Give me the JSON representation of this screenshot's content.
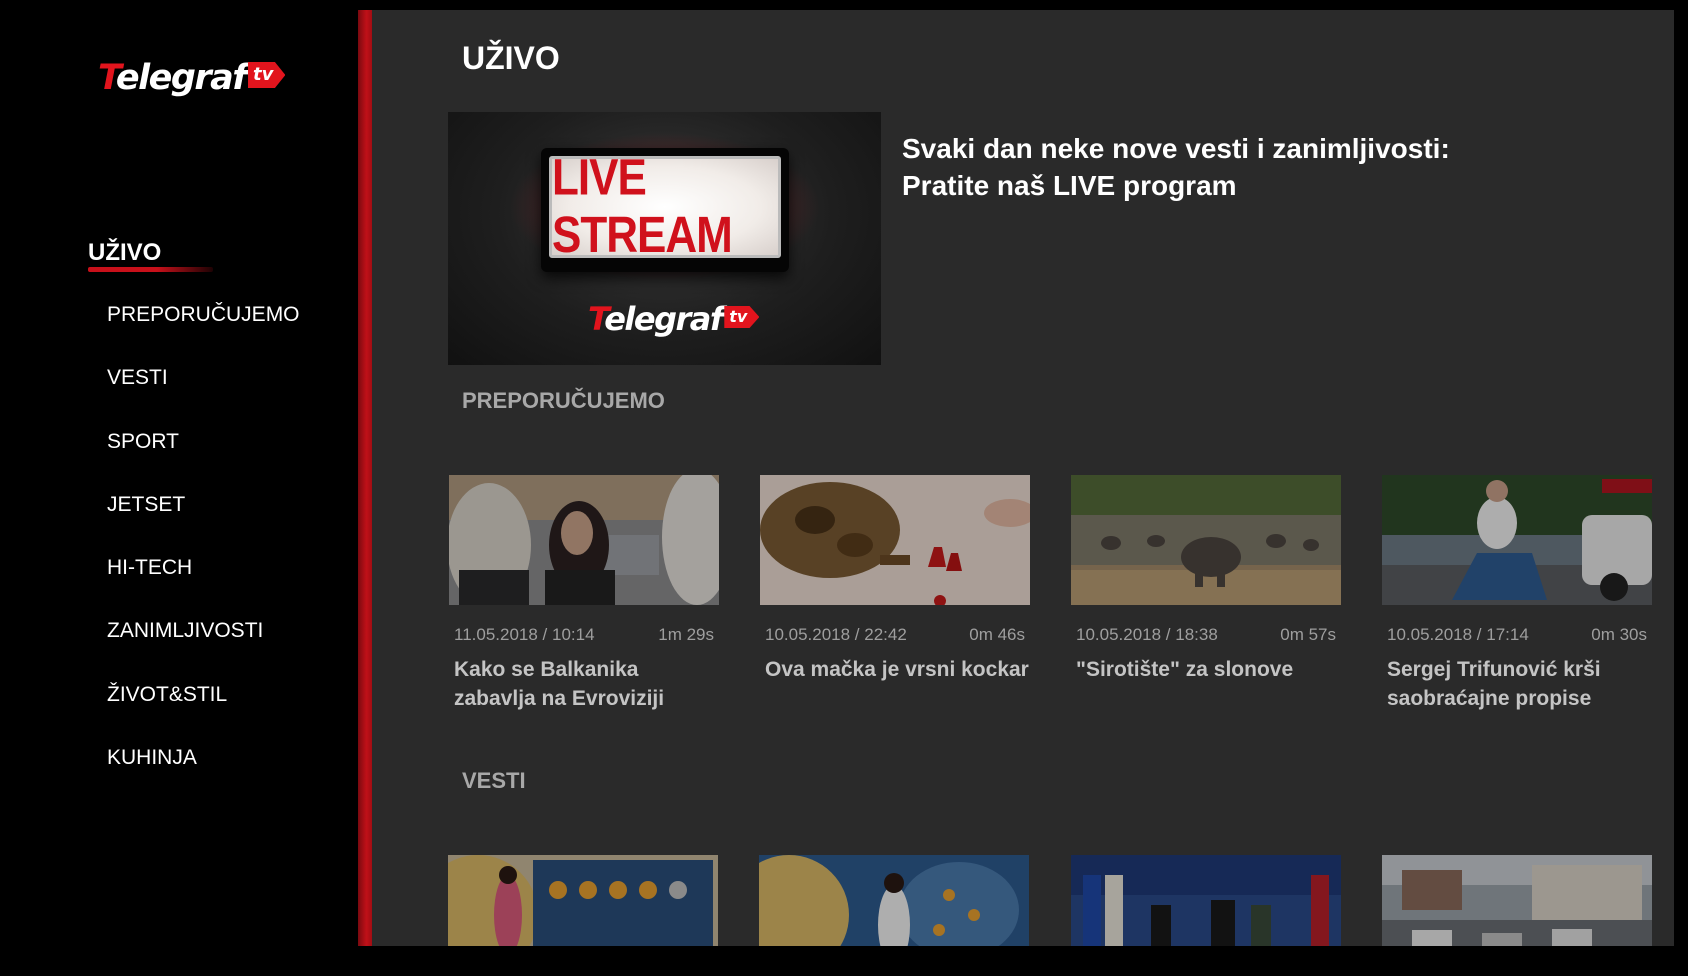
{
  "logo": {
    "first_letter": "T",
    "word_rest": "elegraf",
    "tv": "tv"
  },
  "sidebar": {
    "items": [
      {
        "label": "UŽIVO",
        "active": true
      },
      {
        "label": "PREPORUČUJEMO",
        "active": false
      },
      {
        "label": "VESTI",
        "active": false
      },
      {
        "label": "SPORT",
        "active": false
      },
      {
        "label": "JETSET",
        "active": false
      },
      {
        "label": "HI-TECH",
        "active": false
      },
      {
        "label": "ZANIMLJIVOSTI",
        "active": false
      },
      {
        "label": "ŽIVOT&STIL",
        "active": false
      },
      {
        "label": "KUHINJA",
        "active": false
      }
    ]
  },
  "main": {
    "title": "UŽIVO",
    "live": {
      "sign_text": "LIVE STREAM",
      "description_line1": "Svaki dan neke nove vesti i zanimljivosti:",
      "description_line2": "Pratite naš LIVE program"
    },
    "rows": [
      {
        "title": "PREPORUČUJEMO",
        "cards": [
          {
            "date": "11.05.2018 / 10:14",
            "duration": "1m 29s",
            "title": "Kako se Balkanika zabavlja na Evroviziji"
          },
          {
            "date": "10.05.2018 / 22:42",
            "duration": "0m 46s",
            "title": "Ova mačka je vrsni kockar"
          },
          {
            "date": "10.05.2018 / 18:38",
            "duration": "0m 57s",
            "title": "\"Sirotište\" za slonove"
          },
          {
            "date": "10.05.2018 / 17:14",
            "duration": "0m 30s",
            "title": "Sergej Trifunović krši saobraćajne propise"
          }
        ]
      },
      {
        "title": "VESTI"
      }
    ]
  },
  "colors": {
    "accent": "#c8101a",
    "panel": "#2a2a2a",
    "sidebar": "#000000"
  }
}
